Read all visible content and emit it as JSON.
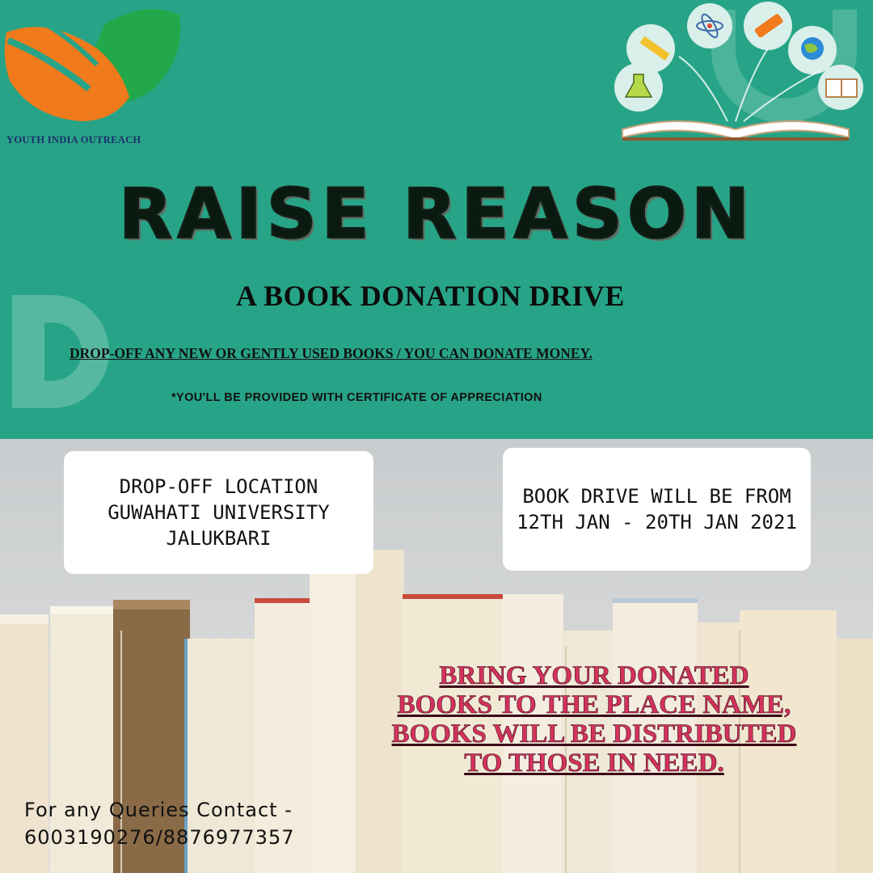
{
  "brand": {
    "name": "YOUTH INDIA OUTREACH",
    "logo_colors": [
      "#f07a1c",
      "#22a84a"
    ]
  },
  "poster": {
    "title": "RAISE REASON",
    "subtitle": "A BOOK DONATION DRIVE",
    "drop_off_line": "DROP-OFF ANY NEW OR GENTLY USED BOOKS / YOU CAN DONATE MONEY.",
    "certificate_note": "*YOU'LL BE PROVIDED WITH CERTIFICATE OF APPRECIATION"
  },
  "location_card": {
    "lines": [
      "DROP-OFF LOCATION",
      "GUWAHATI UNIVERSITY",
      "JALUKBARI"
    ]
  },
  "dates_card": {
    "lines": [
      "BOOK DRIVE WILL BE FROM",
      "12TH JAN - 20TH JAN 2021"
    ]
  },
  "message": {
    "lines": [
      "BRING YOUR DONATED",
      "BOOKS TO THE PLACE NAME,",
      "BOOKS WILL BE DISTRIBUTED",
      "TO THOSE IN NEED."
    ]
  },
  "contact": {
    "line1": "For any Queries Contact -",
    "line2": "6003190276/8876977357"
  },
  "colors": {
    "background_green": "#27a487",
    "message_pink": "#d4325d"
  },
  "decor_icons": [
    "pencil-icon",
    "atom-icon",
    "crayon-icon",
    "globe-icon",
    "flask-icon",
    "book-icon",
    "open-book-icon"
  ]
}
